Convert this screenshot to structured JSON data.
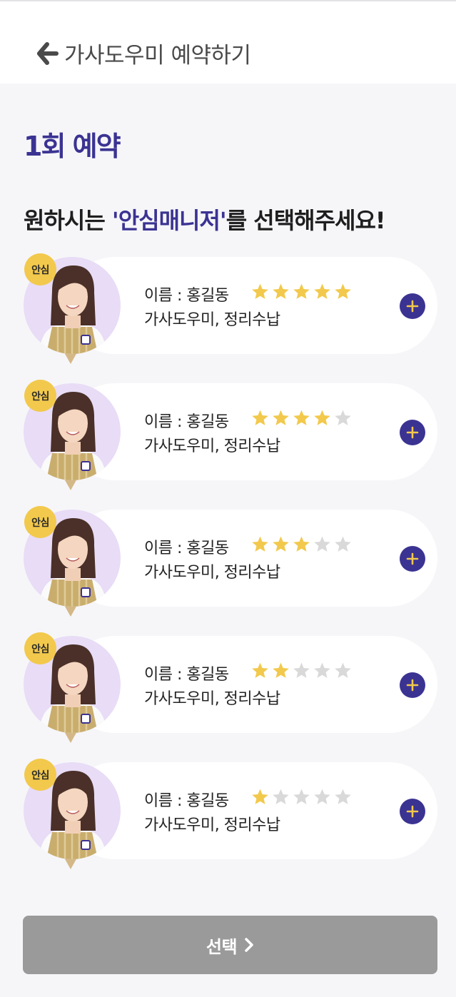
{
  "header": {
    "title": "가사도우미 예약하기",
    "back_icon": "arrow-left-icon"
  },
  "section_title": "1회 예약",
  "prompt": {
    "before": "원하시는 ",
    "highlight": "'안심매니저'",
    "after": "를 선택해주세요!"
  },
  "managers": [
    {
      "badge": "안심",
      "name": "이름 : 홍길동",
      "role": "가사도우미, 정리수납",
      "rating": 5
    },
    {
      "badge": "안심",
      "name": "이름 : 홍길동",
      "role": "가사도우미, 정리수납",
      "rating": 4
    },
    {
      "badge": "안심",
      "name": "이름 : 홍길동",
      "role": "가사도우미, 정리수납",
      "rating": 3
    },
    {
      "badge": "안심",
      "name": "이름 : 홍길동",
      "role": "가사도우미, 정리수납",
      "rating": 2
    },
    {
      "badge": "안심",
      "name": "이름 : 홍길동",
      "role": "가사도우미, 정리수납",
      "rating": 1
    }
  ],
  "rating_max": 5,
  "select_button": {
    "label": "선택",
    "icon": "chevron-right-icon"
  },
  "colors": {
    "accent": "#3b3392",
    "star_on": "#f2c94c",
    "star_off": "#d9d9d9",
    "badge": "#f2c94c",
    "avatar_bg": "#e8dcf6",
    "button_disabled": "#9a9a9a"
  }
}
